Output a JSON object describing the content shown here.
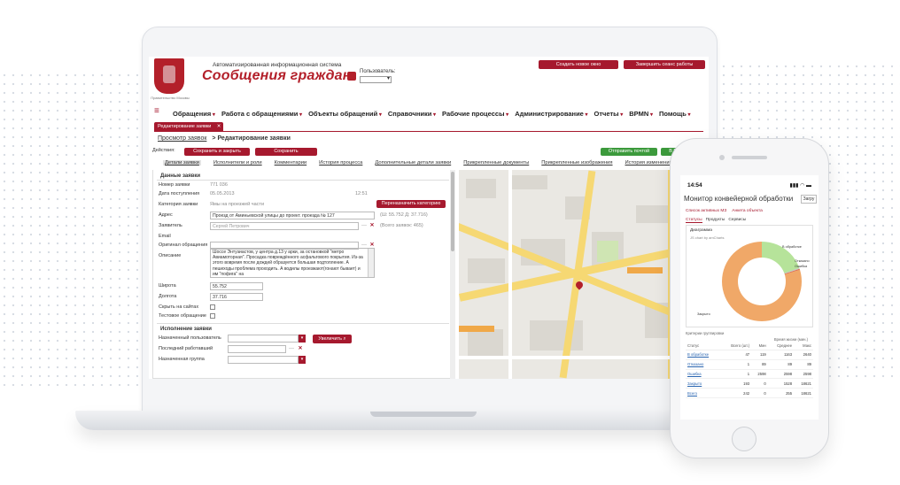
{
  "header": {
    "crest_caption": "Правительство Москвы",
    "system_subtitle": "Автоматизированная информационная система",
    "system_title": "Сообщения граждан",
    "user_label": "Пользователь:",
    "new_window_button": "Создать новое окно",
    "end_session_button": "Завершить сеанс работы"
  },
  "menu": {
    "items": [
      "Обращения",
      "Работа с обращениями",
      "Объекты обращений",
      "Справочники",
      "Рабочие процессы",
      "Администрирование",
      "Отчеты",
      "BPMN",
      "Помощь"
    ]
  },
  "tab": {
    "label": "Редактирование заявки",
    "close": "✕"
  },
  "breadcrumb": {
    "link": "Просмотр заявок",
    "current": "> Редактирование заявки"
  },
  "actions": {
    "label": "Действия:",
    "save_close": "Сохранить и закрыть",
    "save": "Сохранить",
    "send_mail": "Отправить почтой",
    "to_export": "В Ex"
  },
  "subtabs": [
    "Детали заявки",
    "Исполнители и роли",
    "Комментарии",
    "История процесса",
    "Дополнительные детали заявки",
    "Прикрепленные документы",
    "Прикрепленные изображения",
    "История изменений заявки"
  ],
  "form": {
    "section_title": "Данные заявки",
    "number_label": "Номер заявки",
    "number_value": "771 036",
    "received_label": "Дата поступления",
    "received_date": "05.05.2013",
    "received_time": "12:51",
    "category_label": "Категория заявки",
    "category_value": "Ямы на проезжей части",
    "reassign_button": "Переназначить категорию",
    "address_label": "Адрес",
    "address_value": "Проезд от Аминьевской улицы до проект. проезда № 127",
    "coords_note": "(Ш: 55.752 Д: 37.716)",
    "applicant_label": "Заявитель",
    "applicant_value": "Сергей Петрович",
    "applicant_note": "(Всего заявок: 465)",
    "email_label": "Email",
    "original_label": "Оригинал обращения",
    "description_label": "Описание",
    "description_value": "Шоссе Энтузиастов, у центра д.13 у арки, за остановкой \"метро Авиамоторная\". Просадка повреждённого асфальтового покрытия. Из-за этого вовремя после дождей образуется большая подтопление. А пешеходы проблема проходить. А водилы проезжают(гонают бывает) и им \"пофига\" на",
    "lat_label": "Широта",
    "lat_value": "55.752",
    "lon_label": "Долгота",
    "lon_value": "37.716",
    "hide_label": "Скрыть на сайтах",
    "test_label": "Тестовое обращение",
    "exec_title": "Исполнение заявки",
    "assigned_user_label": "Назначенный пользователь",
    "last_worker_label": "Последний работавший",
    "assigned_group_label": "Назначенная группа",
    "zoom_button": "Увеличить"
  },
  "phone": {
    "time": "14:54",
    "signal": "▮▮▮ ◠ ▬",
    "title": "Монитор конвейерной обработки",
    "top_button": "Загру",
    "tabs": [
      "Список активных МЗ",
      "Анкета объекта"
    ],
    "subtabs": [
      "Статусы",
      "Продукты",
      "Сервисы"
    ],
    "card_title": "Диаграмма",
    "card_subtitle": "JS chart by amCharts",
    "legend": [
      "В обработке",
      "Отказано",
      "Ошибка",
      "Закрыто"
    ],
    "table_caption": "Критерии группировки",
    "table_group": "Время жизни (мин.)",
    "columns": [
      "Статус",
      "Всего (шт.)",
      "Мин",
      "Среднее",
      "Макс"
    ],
    "rows": [
      [
        "В обработке",
        "47",
        "119",
        "1163",
        "2640"
      ],
      [
        "Отказано",
        "1",
        "89",
        "89",
        "89"
      ],
      [
        "Ошибка",
        "1",
        "2598",
        "2598",
        "2598"
      ],
      [
        "Закрыто",
        "193",
        "0",
        "1528",
        "18621"
      ],
      [
        "Всего",
        "242",
        "0",
        "255",
        "18621"
      ]
    ]
  },
  "chart_data": {
    "type": "pie",
    "categories": [
      "Закрыто",
      "В обработке",
      "Отказано",
      "Ошибка"
    ],
    "values": [
      193,
      47,
      1,
      1
    ]
  },
  "colors": {
    "brand": "#a6192e",
    "green": "#3c9a3c",
    "donut_main": "#f0a868",
    "donut_second": "#b6e39a"
  }
}
